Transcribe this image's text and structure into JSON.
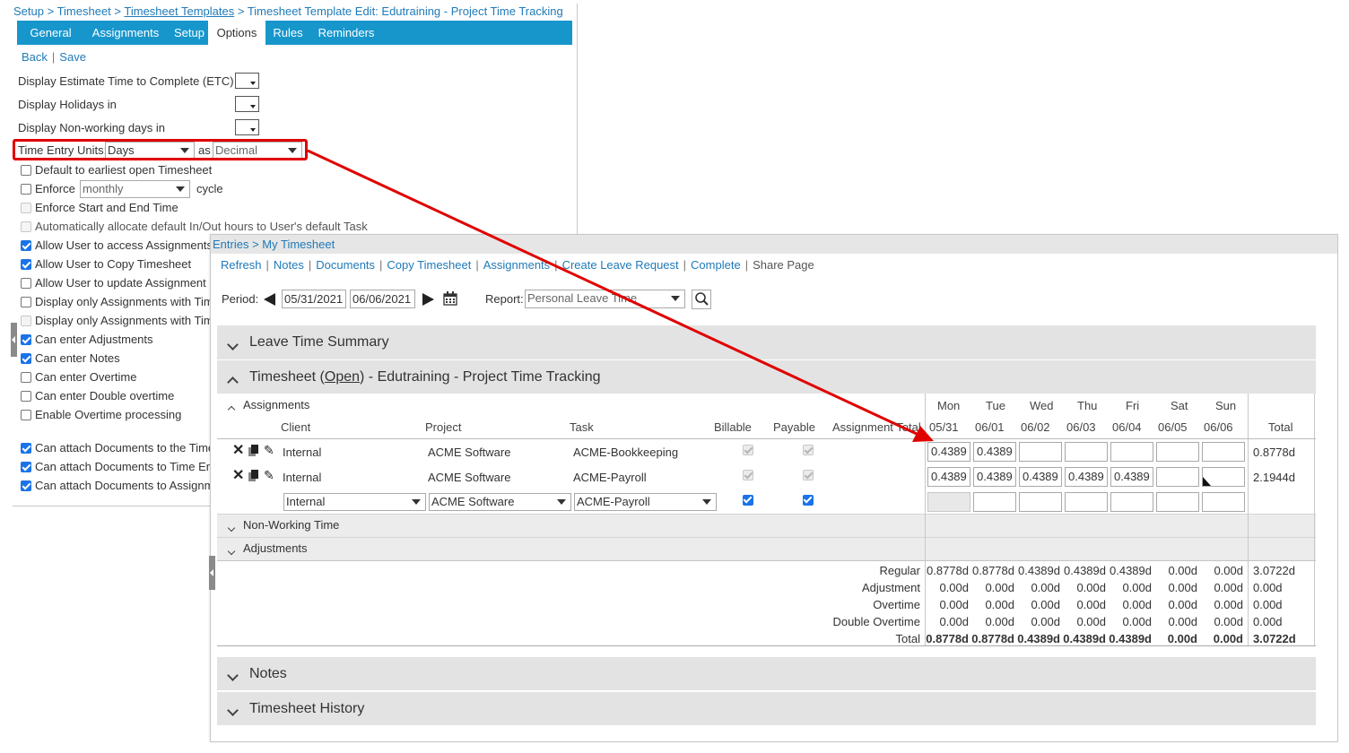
{
  "setup": {
    "breadcrumb": {
      "setup": "Setup",
      "sep": " > ",
      "timesheet": "Timesheet",
      "templates": "Timesheet Templates",
      "current": "Timesheet Template Edit: Edutraining - Project Time Tracking"
    },
    "tabs": [
      "General",
      "Assignments",
      "Setup",
      "Options",
      "Rules",
      "Reminders"
    ],
    "active_tab": "Options",
    "back_label": "Back",
    "save_label": "Save",
    "etc_label": "Display Estimate Time to Complete (ETC) in",
    "holidays_label": "Display Holidays in",
    "nonworking_label": "Display Non-working days in",
    "time_entry_label": "Time Entry Units:",
    "time_entry_value": "Days",
    "as_label": "as",
    "format_value": "Decimal",
    "enforce_value": "monthly",
    "cycle_label": "cycle",
    "options": [
      {
        "label": "Default to earliest open Timesheet",
        "checked": false
      },
      {
        "label": "Enforce",
        "checked": false
      },
      {
        "label": "Enforce Start and End Time",
        "checked": false
      },
      {
        "label": "Automatically allocate default In/Out hours to User's default Task",
        "checked": false,
        "disabled": true
      },
      {
        "label": "Allow User to access Assignments p",
        "checked": true
      },
      {
        "label": "Allow User to Copy Timesheet",
        "checked": true
      },
      {
        "label": "Allow User to update Assignment c",
        "checked": false
      },
      {
        "label": "Display only Assignments with Tim",
        "checked": false
      },
      {
        "label": "Display only Assignments with Tim",
        "checked": false,
        "disabled": true
      },
      {
        "label": "Can enter Adjustments",
        "checked": true
      },
      {
        "label": "Can enter Notes",
        "checked": true
      },
      {
        "label": "Can enter Overtime",
        "checked": false
      },
      {
        "label": "Can enter Double overtime",
        "checked": false
      },
      {
        "label": "Enable Overtime processing",
        "checked": false
      },
      {
        "label": "Can attach Documents to the Time",
        "checked": true
      },
      {
        "label": "Can attach Documents to Time Ent",
        "checked": true
      },
      {
        "label": "Can attach Documents to Assignm",
        "checked": true
      }
    ]
  },
  "entries": {
    "breadcrumb": "Entries > My Timesheet",
    "toolbar": [
      "Refresh",
      "Notes",
      "Documents",
      "Copy Timesheet",
      "Assignments",
      "Create Leave Request",
      "Complete"
    ],
    "toolbar_plain": "Share Page",
    "period_label": "Period:",
    "period_start": "05/31/2021",
    "period_end": "06/06/2021",
    "report_label": "Report:",
    "report_value": "Personal Leave Time",
    "leave_summary": "Leave Time Summary",
    "timesheet_prefix": "Timesheet (",
    "timesheet_status": "Open",
    "timesheet_suffix": ")  - Edutraining - Project Time Tracking",
    "assignments_label": "Assignments",
    "columns": {
      "client": "Client",
      "project": "Project",
      "task": "Task",
      "billable": "Billable",
      "payable": "Payable",
      "assignment_total": "Assignment Total",
      "total": "Total"
    },
    "days": [
      {
        "name": "Mon",
        "date": "05/31"
      },
      {
        "name": "Tue",
        "date": "06/01"
      },
      {
        "name": "Wed",
        "date": "06/02"
      },
      {
        "name": "Thu",
        "date": "06/03"
      },
      {
        "name": "Fri",
        "date": "06/04"
      },
      {
        "name": "Sat",
        "date": "06/05"
      },
      {
        "name": "Sun",
        "date": "06/06"
      }
    ],
    "rows": [
      {
        "client": "Internal",
        "project": "ACME Software",
        "task": "ACME-Bookkeeping",
        "values": [
          "0.4389",
          "0.4389",
          "",
          "",
          "",
          "",
          ""
        ],
        "total": "0.8778d"
      },
      {
        "client": "Internal",
        "project": "ACME Software",
        "task": "ACME-Payroll",
        "values": [
          "0.4389",
          "0.4389",
          "0.4389",
          "0.4389",
          "0.4389",
          "",
          ""
        ],
        "total": "2.1944d"
      }
    ],
    "new_row": {
      "client": "Internal",
      "project": "ACME Software",
      "task": "ACME-Payroll"
    },
    "nonworking_label": "Non-Working Time",
    "adjustments_label": "Adjustments",
    "summary": [
      {
        "label": "Regular",
        "values": [
          "0.8778d",
          "0.8778d",
          "0.4389d",
          "0.4389d",
          "0.4389d",
          "0.00d",
          "0.00d"
        ],
        "total": "3.0722d"
      },
      {
        "label": "Adjustment",
        "values": [
          "0.00d",
          "0.00d",
          "0.00d",
          "0.00d",
          "0.00d",
          "0.00d",
          "0.00d"
        ],
        "total": "0.00d"
      },
      {
        "label": "Overtime",
        "values": [
          "0.00d",
          "0.00d",
          "0.00d",
          "0.00d",
          "0.00d",
          "0.00d",
          "0.00d"
        ],
        "total": "0.00d"
      },
      {
        "label": "Double Overtime",
        "values": [
          "0.00d",
          "0.00d",
          "0.00d",
          "0.00d",
          "0.00d",
          "0.00d",
          "0.00d"
        ],
        "total": "0.00d"
      },
      {
        "label": "Total",
        "values": [
          "0.8778d",
          "0.8778d",
          "0.4389d",
          "0.4389d",
          "0.4389d",
          "0.00d",
          "0.00d"
        ],
        "total": "3.0722d"
      }
    ],
    "notes_label": "Notes",
    "history_label": "Timesheet History"
  },
  "colors": {
    "accent": "#1796cc",
    "link": "#1f7ab8",
    "highlight": "#e00000",
    "checkbox": "#1a73e8"
  }
}
